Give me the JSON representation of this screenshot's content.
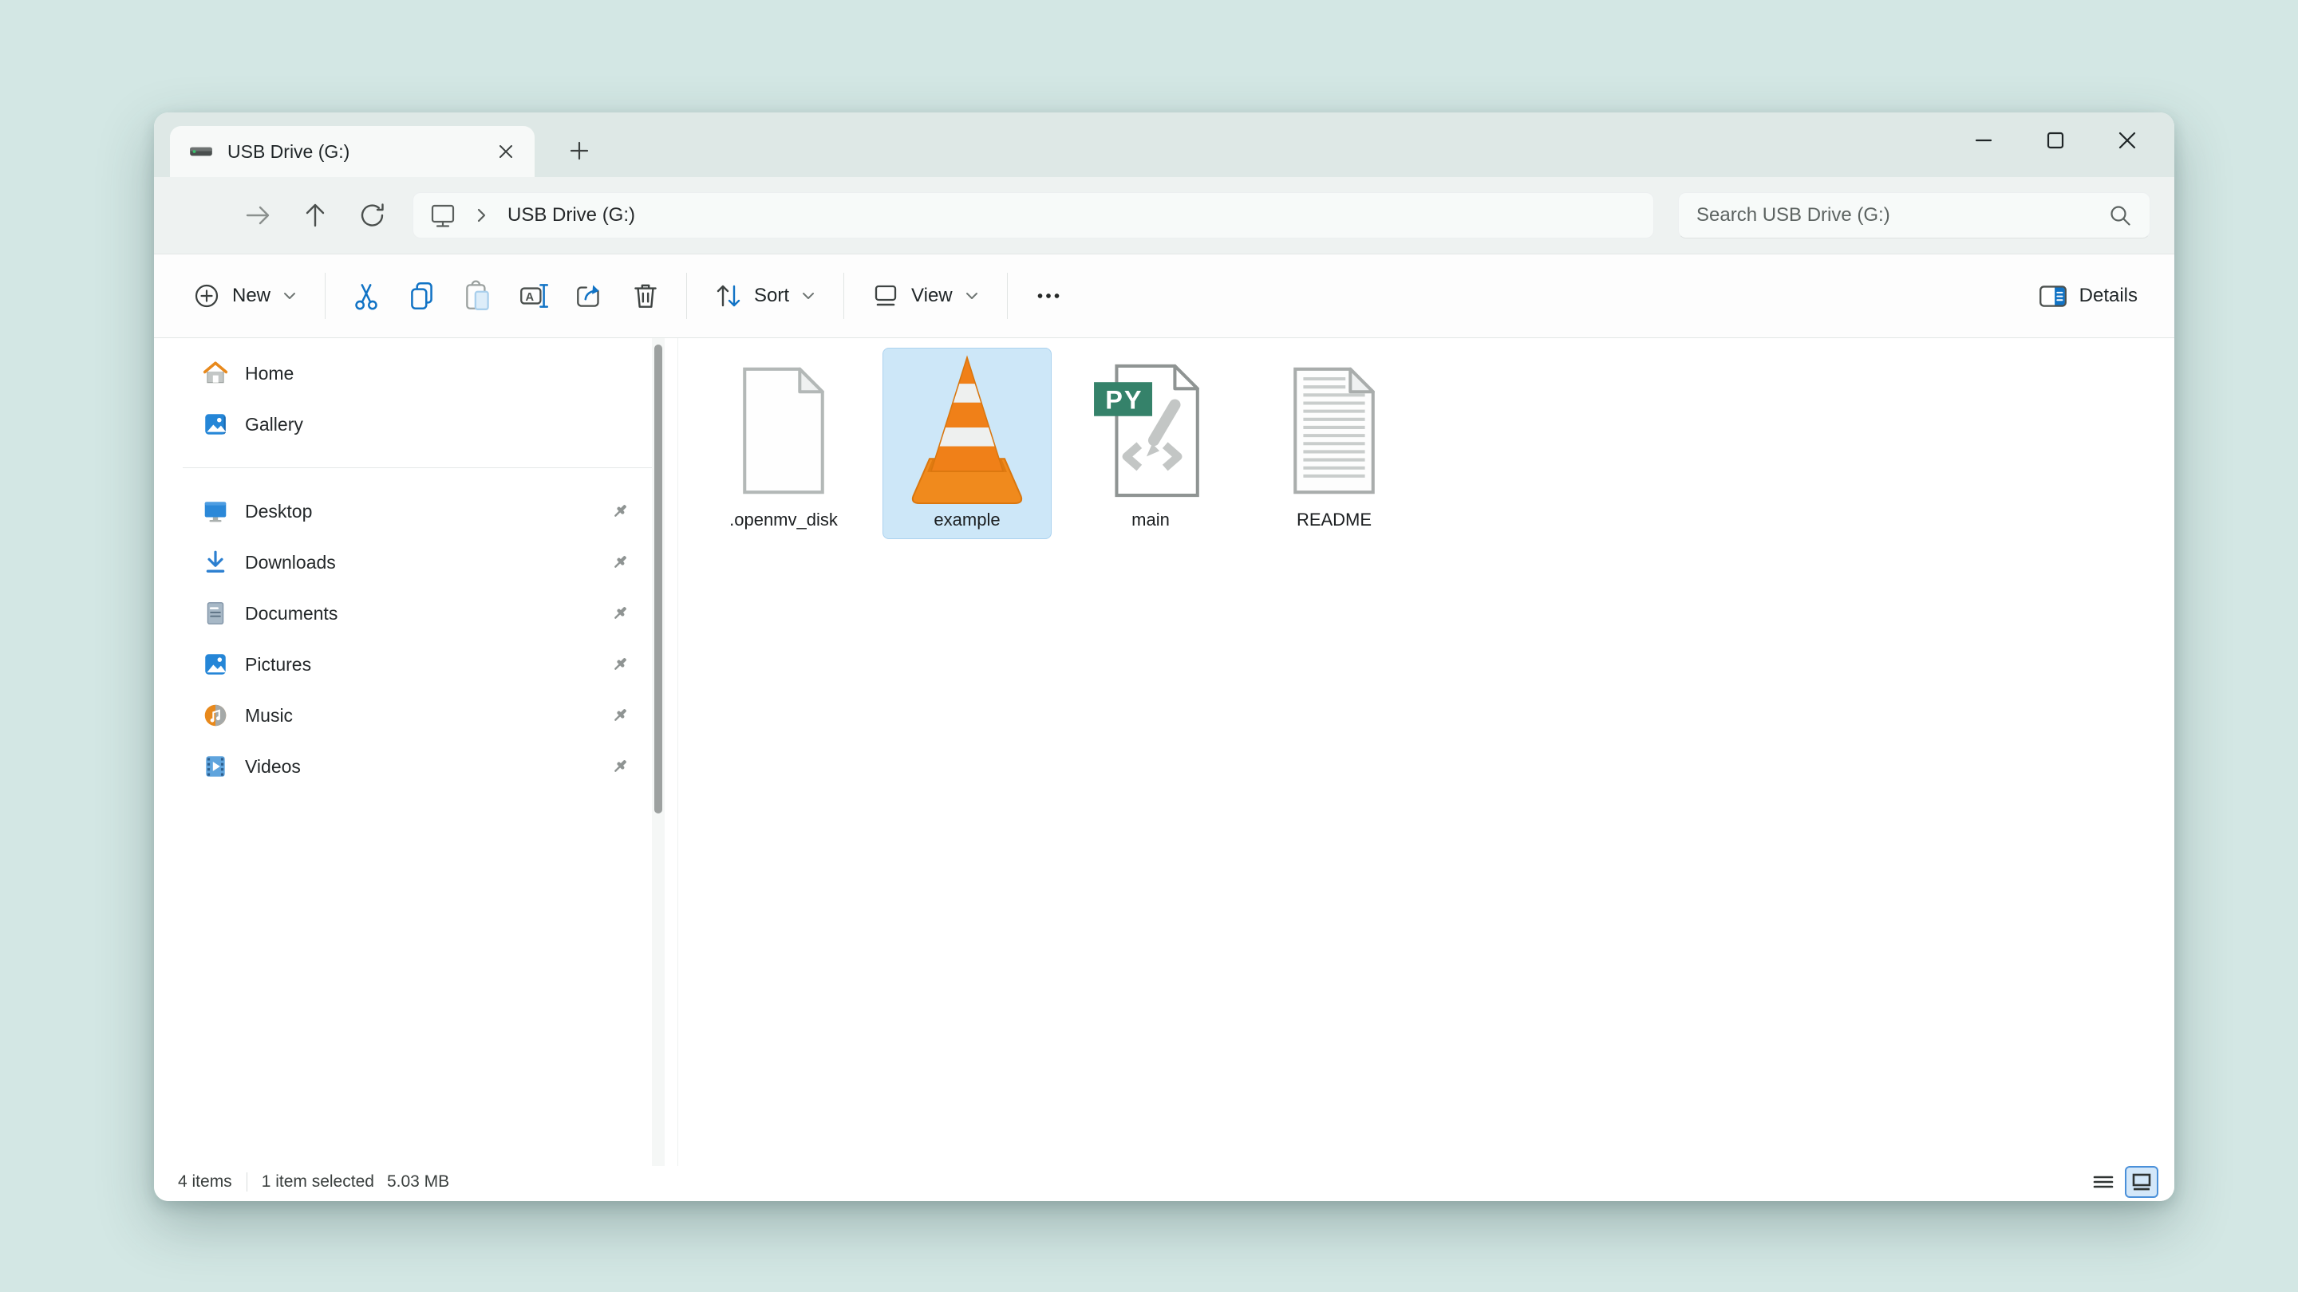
{
  "tabbar": {
    "tab_title": "USB Drive (G:)"
  },
  "navbar": {
    "breadcrumb_path": "USB Drive (G:)",
    "search_placeholder": "Search USB Drive (G:)"
  },
  "toolbar": {
    "new_label": "New",
    "sort_label": "Sort",
    "view_label": "View",
    "details_label": "Details"
  },
  "sidebar": {
    "items": [
      {
        "label": "Home",
        "icon": "home-icon",
        "pinned": false
      },
      {
        "label": "Gallery",
        "icon": "gallery-icon",
        "pinned": false
      },
      {
        "label": "Desktop",
        "icon": "desktop-icon",
        "pinned": true
      },
      {
        "label": "Downloads",
        "icon": "downloads-icon",
        "pinned": true
      },
      {
        "label": "Documents",
        "icon": "documents-icon",
        "pinned": true
      },
      {
        "label": "Pictures",
        "icon": "pictures-icon",
        "pinned": true
      },
      {
        "label": "Music",
        "icon": "music-icon",
        "pinned": true
      },
      {
        "label": "Videos",
        "icon": "videos-icon",
        "pinned": true
      }
    ]
  },
  "files": [
    {
      "name": ".openmv_disk",
      "icon": "blank-file-icon",
      "selected": false
    },
    {
      "name": "example",
      "icon": "vlc-cone-icon",
      "selected": true
    },
    {
      "name": "main",
      "icon": "python-file-icon",
      "selected": false
    },
    {
      "name": "README",
      "icon": "text-file-icon",
      "selected": false
    }
  ],
  "statusbar": {
    "count": "4 items",
    "selected": "1 item selected",
    "size": "5.03 MB"
  },
  "colors": {
    "desktop_background": "#d3e7e4",
    "titlebar": "#dee8e6",
    "chrome_row": "#eef2f1",
    "selection_fill": "#cde7f8",
    "selection_border": "#abd2ef",
    "accent_blue": "#1173c5",
    "python_badge_green": "#35826a",
    "vlc_orange": "#f08018"
  }
}
